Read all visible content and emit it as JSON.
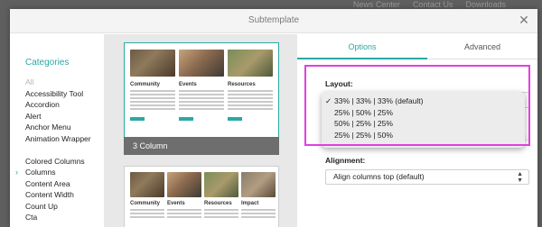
{
  "background_nav": [
    "News Center",
    "Contact Us",
    "Downloads"
  ],
  "modal": {
    "title": "Subtemplate",
    "close_glyph": "✕"
  },
  "sidebar": {
    "heading": "Categories",
    "items": [
      {
        "label": "All"
      },
      {
        "label": "Accessibility Tool"
      },
      {
        "label": "Accordion"
      },
      {
        "label": "Alert"
      },
      {
        "label": "Anchor Menu"
      },
      {
        "label": "Animation Wrapper"
      },
      {
        "label": "Colored Columns"
      },
      {
        "label": "Columns",
        "selected": true
      },
      {
        "label": "Content Area"
      },
      {
        "label": "Content Width"
      },
      {
        "label": "Count Up"
      },
      {
        "label": "Cta"
      }
    ],
    "selected_arrow": "›"
  },
  "previews": {
    "card1": {
      "caption": "3 Column",
      "columns": [
        "Community",
        "Events",
        "Resources"
      ]
    },
    "card2": {
      "columns": [
        "Community",
        "Events",
        "Resources",
        "Impact"
      ]
    }
  },
  "tabs": [
    {
      "label": "Options",
      "active": true
    },
    {
      "label": "Advanced",
      "active": false
    }
  ],
  "layout_field": {
    "label": "Layout:",
    "options": [
      {
        "label": "33% | 33% | 33% (default)",
        "checked": true
      },
      {
        "label": "25% | 50% | 25%"
      },
      {
        "label": "50% | 25% | 25%"
      },
      {
        "label": "25% | 25% | 50%"
      }
    ],
    "check_glyph": "✓"
  },
  "alignment_field": {
    "label": "Alignment:",
    "value": "Align columns top (default)",
    "arrows": "▲\n▼"
  },
  "colors": {
    "accent": "#2aa8a4",
    "highlight": "#e040e0"
  }
}
